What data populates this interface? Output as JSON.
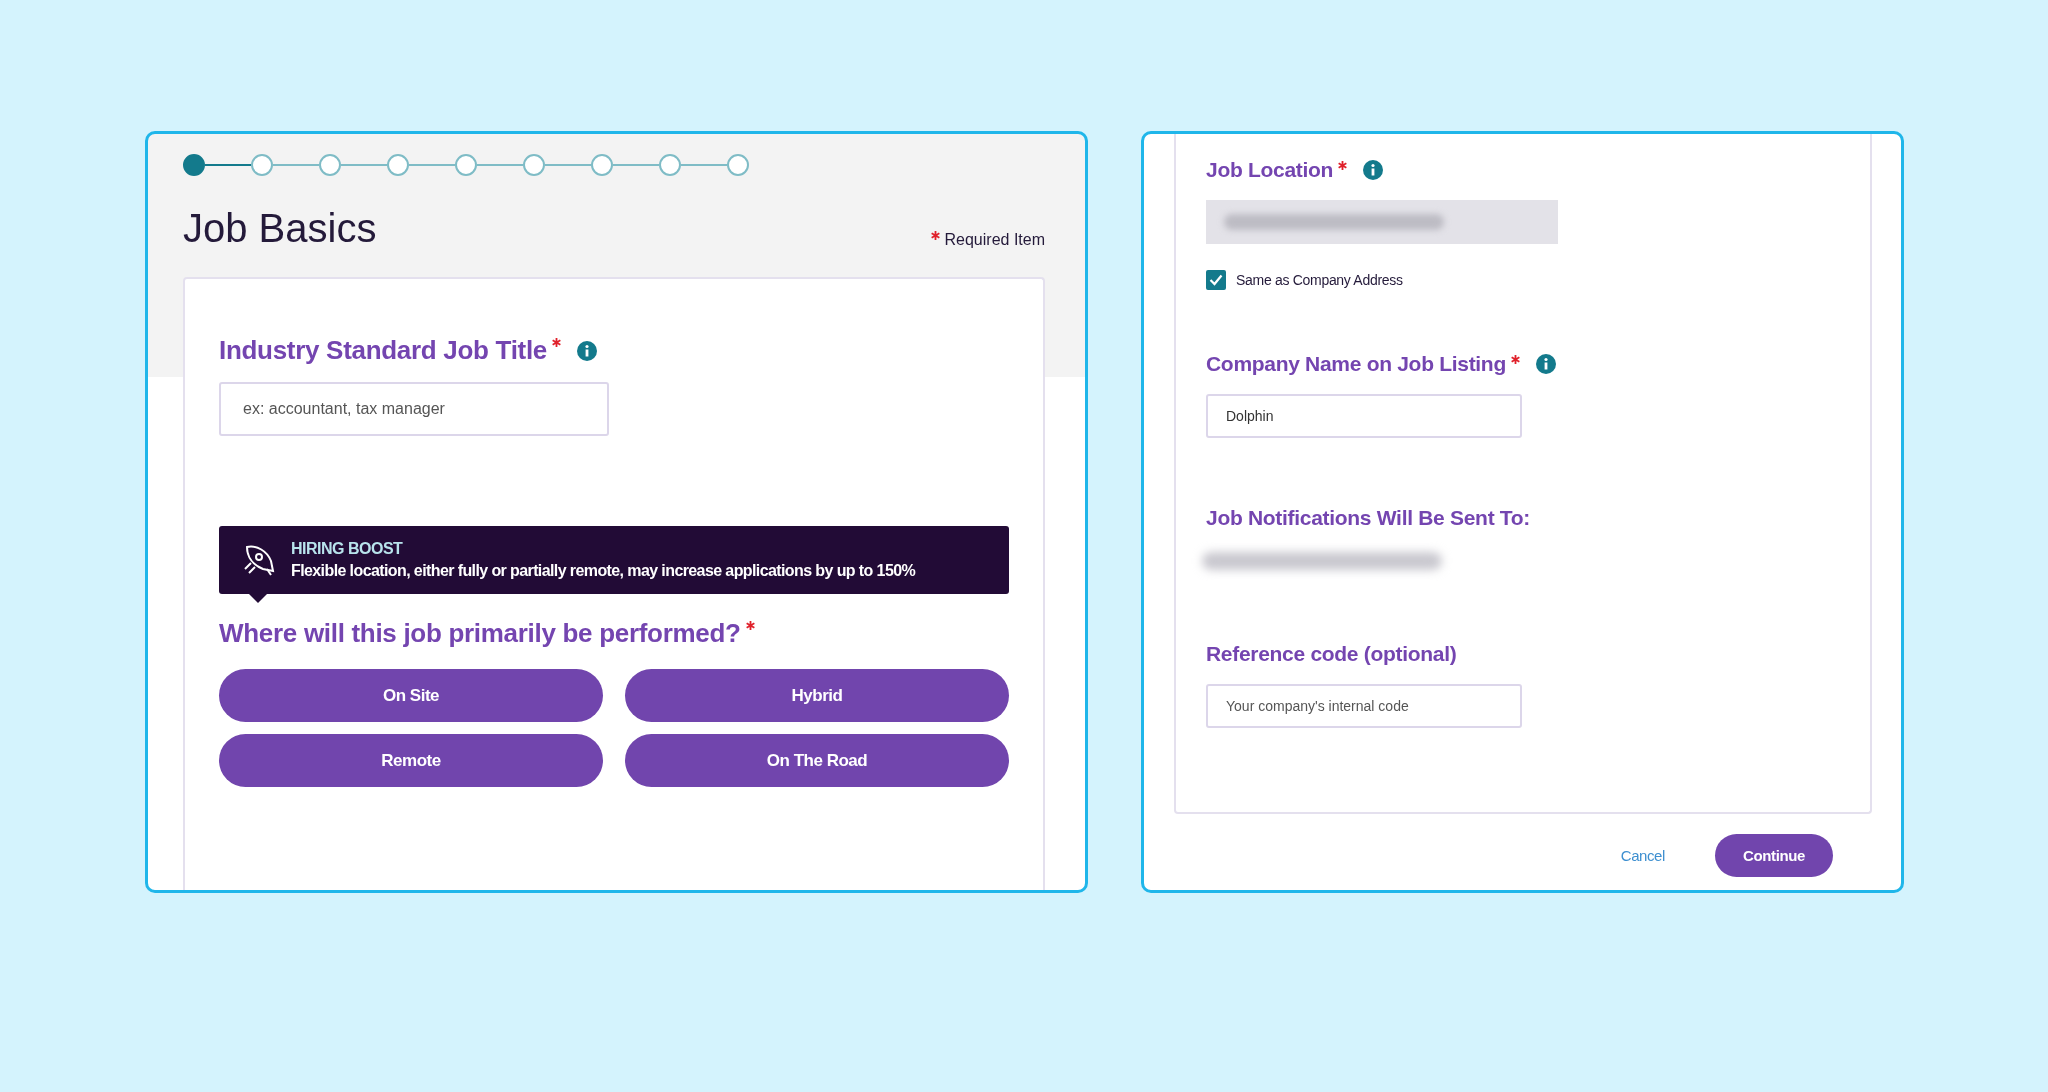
{
  "job_basics": {
    "steps": [
      {
        "selected": true
      },
      {
        "selected": false
      },
      {
        "selected": false
      },
      {
        "selected": false
      },
      {
        "selected": false
      },
      {
        "selected": false
      },
      {
        "selected": false
      },
      {
        "selected": false
      },
      {
        "selected": false
      }
    ],
    "title": "Job Basics",
    "required_note": "Required Item",
    "job_title": {
      "label": "Industry Standard Job Title",
      "required": true,
      "info": true,
      "placeholder": "ex: accountant, tax manager"
    },
    "hiring_boost": {
      "heading": "HIRING BOOST",
      "text": "Flexible location, either fully or partially remote, may increase applications by up to 150%"
    },
    "location_question": {
      "label": "Where will this job primarily be performed?",
      "required": true
    },
    "location_options": [
      {
        "label": "On Site",
        "selected": false
      },
      {
        "label": "Hybrid",
        "selected": false
      },
      {
        "label": "Remote",
        "selected": false
      },
      {
        "label": "On The Road",
        "selected": false
      }
    ]
  },
  "job_details": {
    "job_location": {
      "label": "Job Location",
      "required": true,
      "info": true,
      "disabled": true
    },
    "same_as_company": {
      "label": "Same as Company Address",
      "checked": true
    },
    "company_name": {
      "label": "Company Name on Job Listing",
      "required": true,
      "info": true,
      "value": "Dolphin"
    },
    "notifications": {
      "label": "Job Notifications Will Be Sent To:"
    },
    "reference_code": {
      "label": "Reference code (optional)",
      "placeholder": "Your company's internal code"
    },
    "buttons": [
      {
        "kind": "link",
        "label": "Cancel"
      },
      {
        "kind": "primary",
        "label": "Continue"
      }
    ]
  }
}
